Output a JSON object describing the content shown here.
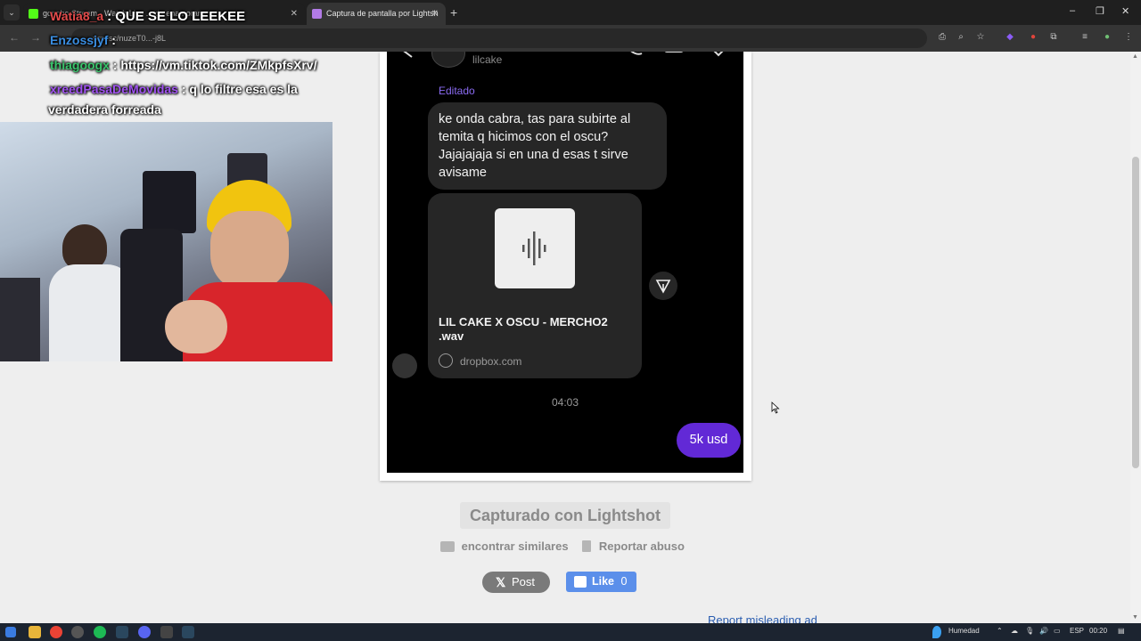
{
  "browser": {
    "tabs": [
      {
        "label": "goncho Stream - Watch Live ... de enamorar",
        "active": false
      },
      {
        "label": "Captura de pantalla por Lightsh",
        "active": true
      }
    ],
    "new_tab": "+",
    "url": "prnt.sc/nuzeT0...-j8L",
    "window_controls": [
      "–",
      "❐",
      "✕"
    ]
  },
  "stream_overlay": {
    "chat": [
      {
        "user": "Watia8_a",
        "user_color": "#e34b4b",
        "message": ": QUE SE LO LEEKEE"
      },
      {
        "user": "Enzossjyf",
        "user_color": "#3a8de0",
        "message": ":"
      },
      {
        "user": "thiagoogx",
        "user_color": "#39c46b",
        "message": ": https://vm.tiktok.com/ZMkpfsXrv/"
      },
      {
        "user": "xreedPasaDeMovidas",
        "user_color": "#a052f0",
        "message": ": q lo filtre esa es la"
      },
      {
        "user": "",
        "user_color": "#ffffff",
        "message": "verdadera forreada"
      }
    ]
  },
  "screenshot": {
    "contact_name": "lilcake",
    "edited_label": "Editado",
    "message_text": "ke onda cabra, tas para subirte al temita q hicimos con el oscu? Jajajajaja si en una d esas t sirve avisame",
    "file_name": "LIL CAKE X OSCU - MERCHO2 .wav",
    "file_domain": "dropbox.com",
    "timestamp": "04:03",
    "reply": "5k usd"
  },
  "page": {
    "captured_label": "Capturado con Lightshot",
    "find_similar": "encontrar similares",
    "report_abuse": "Reportar abuso",
    "post_label": "Post",
    "like_label": "Like",
    "like_count": "0",
    "report_ad": "Report misleading ad"
  },
  "taskbar": {
    "weather": "Humedad",
    "lang": "ESP",
    "time": "00:20"
  },
  "colors": {
    "page_bg": "#eeeeee",
    "ig_purple": "#6229d6",
    "like_blue": "#5b8fea"
  }
}
